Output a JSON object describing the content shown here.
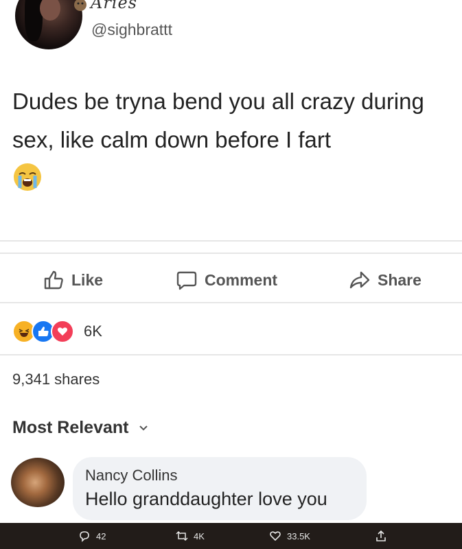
{
  "tweet": {
    "display_name": "Aries",
    "handle": "@sighbrattt",
    "text": "Dudes be tryna bend you all crazy during sex, like calm down before I fart",
    "emoji": "loudly-crying-face"
  },
  "actions": {
    "like_label": "Like",
    "comment_label": "Comment",
    "share_label": "Share"
  },
  "reactions": {
    "icons": [
      "haha-reaction-icon",
      "like-reaction-icon",
      "love-reaction-icon"
    ],
    "count": "6K"
  },
  "shares_text": "9,341 shares",
  "sort_label": "Most Relevant",
  "comment": {
    "author": "Nancy Collins",
    "text": "Hello granddaughter love you"
  },
  "twitter_stats": {
    "replies": "42",
    "retweets": "4K",
    "likes": "33.5K"
  },
  "colors": {
    "bottom_bar": "#221c19",
    "bubble": "#f0f2f5",
    "love": "#f33e58",
    "like": "#1877f2",
    "haha": "#f7b125"
  }
}
